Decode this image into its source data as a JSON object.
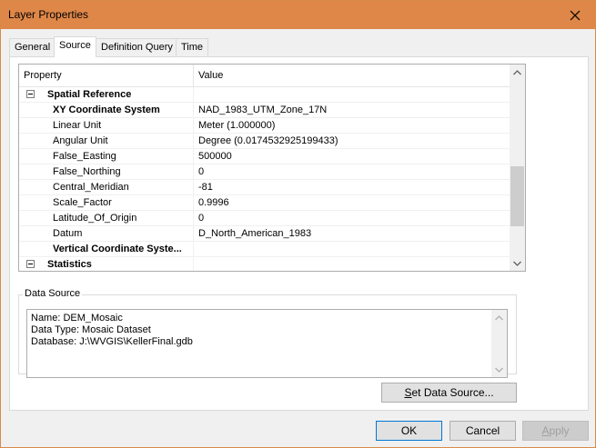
{
  "window": {
    "title": "Layer Properties"
  },
  "tabs": [
    {
      "label": "General"
    },
    {
      "label": "Source"
    },
    {
      "label": "Definition Query"
    },
    {
      "label": "Time"
    }
  ],
  "grid": {
    "header": {
      "property": "Property",
      "value": "Value"
    },
    "rows": [
      {
        "property": "Spatial Reference",
        "value": ""
      },
      {
        "property": "XY Coordinate System",
        "value": "NAD_1983_UTM_Zone_17N"
      },
      {
        "property": "Linear Unit",
        "value": "Meter (1.000000)"
      },
      {
        "property": "Angular Unit",
        "value": "Degree (0.0174532925199433)"
      },
      {
        "property": "False_Easting",
        "value": "500000"
      },
      {
        "property": "False_Northing",
        "value": "0"
      },
      {
        "property": "Central_Meridian",
        "value": "-81"
      },
      {
        "property": "Scale_Factor",
        "value": "0.9996"
      },
      {
        "property": "Latitude_Of_Origin",
        "value": "0"
      },
      {
        "property": "Datum",
        "value": "D_North_American_1983"
      },
      {
        "property": "Vertical Coordinate Syste...",
        "value": ""
      },
      {
        "property": "Statistics",
        "value": ""
      }
    ]
  },
  "data_source": {
    "legend": "Data Source",
    "lines": [
      "Name: DEM_Mosaic",
      "Data Type: Mosaic Dataset",
      "Database: J:\\WVGIS\\KellerFinal.gdb"
    ]
  },
  "buttons": {
    "set_data_source": {
      "prefix": "",
      "accel": "S",
      "rest": "et Data Source..."
    },
    "ok": "OK",
    "cancel": "Cancel",
    "apply": {
      "accel": "A",
      "rest": "pply"
    }
  },
  "icons": {
    "close": "close-icon",
    "collapse": "collapse-icon",
    "scroll_up": "chevron-up-icon",
    "scroll_down": "chevron-down-icon"
  },
  "colors": {
    "titlebar": "#df8748",
    "default_button_border": "#0078d7"
  }
}
